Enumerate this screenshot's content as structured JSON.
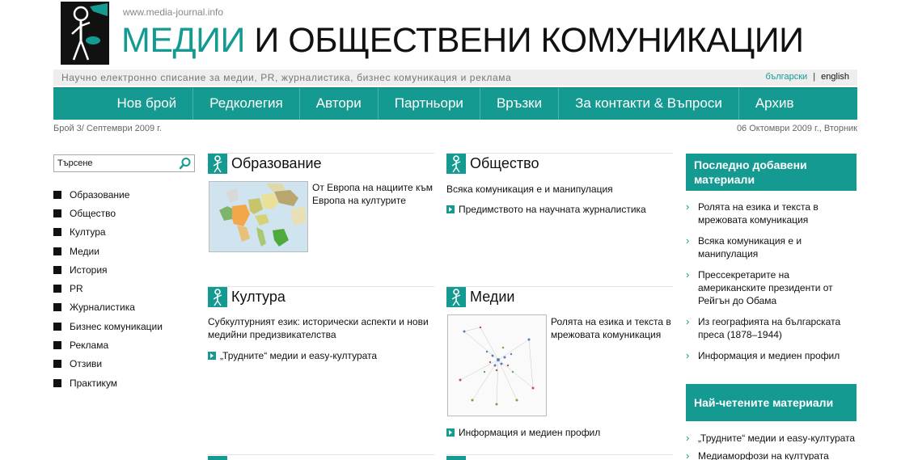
{
  "header": {
    "url": "www.media-journal.info",
    "title_accent": "МЕДИИ",
    "title_rest": "И ОБЩЕСТВЕНИ КОМУНИКАЦИИ",
    "tagline": "Научно електронно списание за медии, PR, журналистика, бизнес комуникация и реклама",
    "lang_bg": "български",
    "lang_sep": "|",
    "lang_en": "english"
  },
  "nav": [
    "Нов брой",
    "Редколегия",
    "Автори",
    "Партньори",
    "Връзки",
    "За контакти & Въпроси",
    "Архив"
  ],
  "issue": "Брой 3/ Септември 2009 г.",
  "date": "06 Октомври 2009 г., Вторник",
  "search": {
    "value": "Търсене"
  },
  "categories": [
    "Образование",
    "Общество",
    "Култура",
    "Медии",
    "История",
    "PR",
    "Журналистика",
    "Бизнес комуникации",
    "Реклама",
    "Отзиви",
    "Практикум"
  ],
  "sections": {
    "education": {
      "title": "Образование",
      "text": "От Европа на нациите към Европа на културите"
    },
    "society": {
      "title": "Общество",
      "text": "Всяка комуникация е и манипулация",
      "link": "Предимството на научната журналистика"
    },
    "culture": {
      "title": "Култура",
      "text": "Субкултурният език: исторически аспекти и нови медийни предизвикателства",
      "link": "„Трудните“ медии и easy-културата"
    },
    "media": {
      "title": "Медии",
      "text": "Ролята на езика и текста в мрежовата комуникация",
      "link": "Информация и медиен профил"
    }
  },
  "recent": {
    "title": "Последно добавени материали",
    "items": [
      "Ролята на езика и текста в мрежовата комуникация",
      "Всяка комуникация е и манипулация",
      "Прессекретарите на американските президенти от Рейгън до Обама",
      "Из географията на българската преса (1878–1944)",
      "Информация и медиен профил"
    ]
  },
  "popular": {
    "title": "Най-четените материали",
    "items": [
      "„Трудните“ медии и easy-културата",
      "Медиаморфози на културата"
    ]
  },
  "colors": {
    "accent": "#159a92",
    "nav_divider": "#43b5ae",
    "tagline_bg": "#eeeeee"
  },
  "icons": {
    "logo": "person-megaphone-logo",
    "section": "person-section-icon",
    "search": "magnifier-icon",
    "link": "arrow-square-icon",
    "list": "chevron-right-icon"
  }
}
